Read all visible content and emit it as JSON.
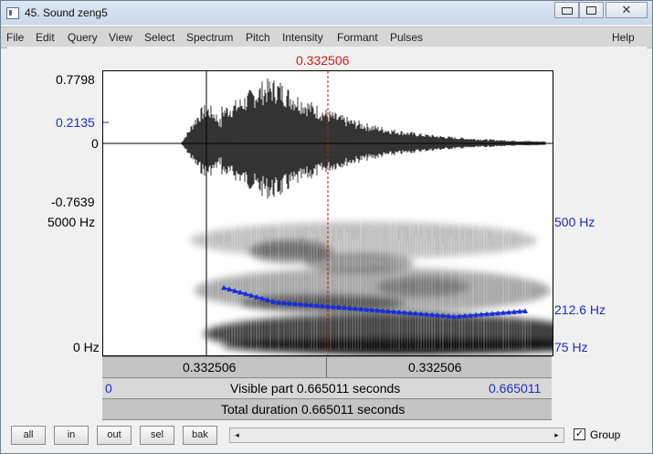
{
  "window": {
    "title": "45. Sound zeng5",
    "min_icon": "minimize-icon",
    "max_icon": "restore-icon",
    "close_icon": "close-icon"
  },
  "menu": [
    "File",
    "Edit",
    "Query",
    "View",
    "Select",
    "Spectrum",
    "Pitch",
    "Intensity",
    "Formant",
    "Pulses"
  ],
  "help": "Help",
  "cursor_time": "0.332506",
  "waveform": {
    "y_max": "0.7798",
    "y_cursor": "0.2135",
    "y_zero": "0",
    "y_min": "-0.7639"
  },
  "spectrogram": {
    "left_top": "5000 Hz",
    "left_bottom": "0 Hz",
    "right_top": "500 Hz",
    "right_mid": "212.6 Hz",
    "right_bottom": "75 Hz"
  },
  "time_bar": {
    "left_segment": "0.332506",
    "right_segment": "0.332506"
  },
  "visible_bar": {
    "start": "0",
    "text": "Visible part 0.665011 seconds",
    "end": "0.665011"
  },
  "total_bar": {
    "text": "Total duration 0.665011 seconds"
  },
  "buttons": [
    "all",
    "in",
    "out",
    "sel",
    "bak"
  ],
  "scroll": {
    "left_arrow": "◂",
    "right_arrow": "▸"
  },
  "group": {
    "label": "Group",
    "checked": true
  },
  "colors": {
    "cursor": "#d11b1b",
    "pitch": "#1a2ed6",
    "axis_label": "#1f2fb6"
  }
}
